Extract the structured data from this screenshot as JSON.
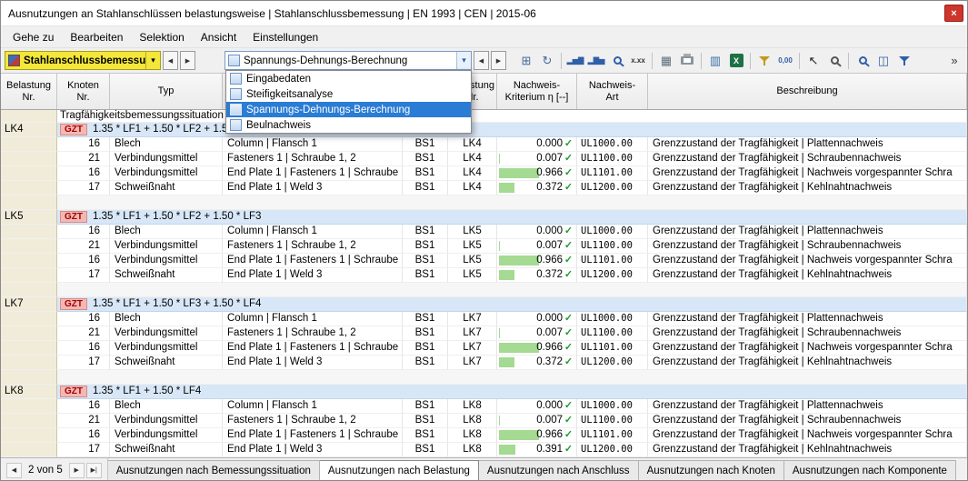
{
  "window": {
    "title": "Ausnutzungen an Stahlanschlüssen belastungsweise | Stahlanschlussbemessung | EN 1993 | CEN | 2015-06",
    "close_glyph": "×"
  },
  "menubar": {
    "items": [
      "Gehe zu",
      "Bearbeiten",
      "Selektion",
      "Ansicht",
      "Einstellungen"
    ]
  },
  "toolbar": {
    "module_combo": {
      "value": "Stahlanschlussbemessung"
    },
    "calc_combo": {
      "value": "Spannungs-Dehnungs-Berechnung"
    },
    "icons": [
      {
        "name": "copy-table-icon",
        "kind": "glyph",
        "glyph": "⊞",
        "color": "#44699d"
      },
      {
        "name": "recalculate-icon",
        "kind": "glyph",
        "glyph": "↻",
        "color": "#44699d"
      },
      {
        "kind": "sep"
      },
      {
        "name": "result-diagram-icon",
        "kind": "glyph",
        "glyph": "▂▅▇",
        "color": "#2f5fa8",
        "size": 8
      },
      {
        "name": "result-diagram-member-icon",
        "kind": "glyph",
        "glyph": "▂▇▅",
        "color": "#2f5fa8",
        "size": 8
      },
      {
        "name": "stress-view-icon",
        "kind": "magnifier",
        "color": "#2f5fa8"
      },
      {
        "name": "extreme-values-icon",
        "kind": "glyph",
        "glyph": "x.xx",
        "color": "#333333",
        "size": 8
      },
      {
        "kind": "sep"
      },
      {
        "name": "tables-icon",
        "kind": "glyph",
        "glyph": "▦",
        "color": "#5f6e7d"
      },
      {
        "name": "print-icon",
        "kind": "printer",
        "color": "#8a949e"
      },
      {
        "kind": "sep"
      },
      {
        "name": "result-chart-icon",
        "kind": "glyph",
        "glyph": "▥",
        "color": "#3a6ea5"
      },
      {
        "name": "excel-export-icon",
        "kind": "excel",
        "glyph": "X",
        "color": "#1e7145"
      },
      {
        "kind": "sep"
      },
      {
        "name": "filter-icon",
        "kind": "funnel",
        "color": "#c49a1a"
      },
      {
        "name": "decimal-places-icon",
        "kind": "glyph",
        "glyph": "0,00",
        "color": "#2f5fa8",
        "size": 8
      },
      {
        "kind": "sep"
      },
      {
        "name": "pointer-icon",
        "kind": "glyph",
        "glyph": "↖",
        "color": "#222222"
      },
      {
        "name": "search-icon",
        "kind": "magnifier",
        "color": "#555555"
      },
      {
        "kind": "sep"
      },
      {
        "name": "zoom-icon",
        "kind": "magnifier",
        "color": "#2f5fa8"
      },
      {
        "name": "panels-icon",
        "kind": "glyph",
        "glyph": "◫",
        "color": "#2f5fa8"
      },
      {
        "name": "filter-results-icon",
        "kind": "funnel",
        "color": "#2f5fa8"
      },
      {
        "name": "more-buttons-icon",
        "kind": "glyph",
        "glyph": "»",
        "color": "#333333"
      }
    ]
  },
  "dropdown": {
    "items": [
      {
        "label": "Eingabedaten",
        "selected": false
      },
      {
        "label": "Steifigkeitsanalyse",
        "selected": false
      },
      {
        "label": "Spannungs-Dehnungs-Berechnung",
        "selected": true
      },
      {
        "label": "Beulnachweis",
        "selected": false
      }
    ]
  },
  "table": {
    "headers": {
      "c1a": "Belastung",
      "c1b": "Nr.",
      "c2a": "Knoten",
      "c2b": "Nr.",
      "c3": "Typ",
      "c4": "",
      "c5": "",
      "c6a": "Belastung",
      "c6b": "Nr.",
      "c7a": "Nachweis-",
      "c7b": "Kriterium η [--]",
      "c8a": "Nachweis-",
      "c8b": "Art",
      "c9": "Beschreibung"
    },
    "section_label": "Tragfähigkeitsbemessungssituation",
    "check_glyph": "✓",
    "colors": {
      "eta_bar": "#a4da92",
      "check": "#1d9e2f",
      "badge_bg": "#f3b8b4",
      "badge_text": "#a40000",
      "group_row_bg": "#d8e7f7",
      "row_header_bg": "#f1ecda",
      "selection_blue": "#2a7cd4",
      "module_combo_yellow": "#f3e73b"
    },
    "groups": [
      {
        "id": "LK4",
        "badge": "GZT",
        "formula": "1.35 * LF1 + 1.50 * LF2 + 1.50 * LF3 + 1.50 * LF4",
        "rows": [
          {
            "knoten": "16",
            "typ": "Blech",
            "komponente": "Column | Flansch 1",
            "bs": "BS1",
            "belastung": "LK4",
            "eta": "0.000",
            "eta_value": 0.0,
            "art": "UL1000.00",
            "beschreibung": "Grenzzustand der Tragfähigkeit | Plattennachweis"
          },
          {
            "knoten": "21",
            "typ": "Verbindungsmittel",
            "komponente": "Fasteners 1 | Schraube 1, 2",
            "bs": "BS1",
            "belastung": "LK4",
            "eta": "0.007",
            "eta_value": 0.007,
            "art": "UL1100.00",
            "beschreibung": "Grenzzustand der Tragfähigkeit | Schraubennachweis"
          },
          {
            "knoten": "16",
            "typ": "Verbindungsmittel",
            "komponente": "End Plate 1 | Fasteners 1 | Schraube 1, 2",
            "bs": "BS1",
            "belastung": "LK4",
            "eta": "0.966",
            "eta_value": 0.966,
            "art": "UL1101.00",
            "beschreibung": "Grenzzustand der Tragfähigkeit | Nachweis vorgespannter Schra"
          },
          {
            "knoten": "17",
            "typ": "Schweißnaht",
            "komponente": "End Plate 1 | Weld 3",
            "bs": "BS1",
            "belastung": "LK4",
            "eta": "0.372",
            "eta_value": 0.372,
            "art": "UL1200.00",
            "beschreibung": "Grenzzustand der Tragfähigkeit | Kehlnahtnachweis"
          }
        ]
      },
      {
        "id": "LK5",
        "badge": "GZT",
        "formula": "1.35 * LF1 + 1.50 * LF2 + 1.50 * LF3",
        "rows": [
          {
            "knoten": "16",
            "typ": "Blech",
            "komponente": "Column | Flansch 1",
            "bs": "BS1",
            "belastung": "LK5",
            "eta": "0.000",
            "eta_value": 0.0,
            "art": "UL1000.00",
            "beschreibung": "Grenzzustand der Tragfähigkeit | Plattennachweis"
          },
          {
            "knoten": "21",
            "typ": "Verbindungsmittel",
            "komponente": "Fasteners 1 | Schraube 1, 2",
            "bs": "BS1",
            "belastung": "LK5",
            "eta": "0.007",
            "eta_value": 0.007,
            "art": "UL1100.00",
            "beschreibung": "Grenzzustand der Tragfähigkeit | Schraubennachweis"
          },
          {
            "knoten": "16",
            "typ": "Verbindungsmittel",
            "komponente": "End Plate 1 | Fasteners 1 | Schraube 1, 2",
            "bs": "BS1",
            "belastung": "LK5",
            "eta": "0.966",
            "eta_value": 0.966,
            "art": "UL1101.00",
            "beschreibung": "Grenzzustand der Tragfähigkeit | Nachweis vorgespannter Schra"
          },
          {
            "knoten": "17",
            "typ": "Schweißnaht",
            "komponente": "End Plate 1 | Weld 3",
            "bs": "BS1",
            "belastung": "LK5",
            "eta": "0.372",
            "eta_value": 0.372,
            "art": "UL1200.00",
            "beschreibung": "Grenzzustand der Tragfähigkeit | Kehlnahtnachweis"
          }
        ]
      },
      {
        "id": "LK7",
        "badge": "GZT",
        "formula": "1.35 * LF1 + 1.50 * LF3 + 1.50 * LF4",
        "rows": [
          {
            "knoten": "16",
            "typ": "Blech",
            "komponente": "Column | Flansch 1",
            "bs": "BS1",
            "belastung": "LK7",
            "eta": "0.000",
            "eta_value": 0.0,
            "art": "UL1000.00",
            "beschreibung": "Grenzzustand der Tragfähigkeit | Plattennachweis"
          },
          {
            "knoten": "21",
            "typ": "Verbindungsmittel",
            "komponente": "Fasteners 1 | Schraube 1, 2",
            "bs": "BS1",
            "belastung": "LK7",
            "eta": "0.007",
            "eta_value": 0.007,
            "art": "UL1100.00",
            "beschreibung": "Grenzzustand der Tragfähigkeit | Schraubennachweis"
          },
          {
            "knoten": "16",
            "typ": "Verbindungsmittel",
            "komponente": "End Plate 1 | Fasteners 1 | Schraube 1, 2",
            "bs": "BS1",
            "belastung": "LK7",
            "eta": "0.966",
            "eta_value": 0.966,
            "art": "UL1101.00",
            "beschreibung": "Grenzzustand der Tragfähigkeit | Nachweis vorgespannter Schra"
          },
          {
            "knoten": "17",
            "typ": "Schweißnaht",
            "komponente": "End Plate 1 | Weld 3",
            "bs": "BS1",
            "belastung": "LK7",
            "eta": "0.372",
            "eta_value": 0.372,
            "art": "UL1200.00",
            "beschreibung": "Grenzzustand der Tragfähigkeit | Kehlnahtnachweis"
          }
        ]
      },
      {
        "id": "LK8",
        "badge": "GZT",
        "formula": "1.35 * LF1 + 1.50 * LF4",
        "rows": [
          {
            "knoten": "16",
            "typ": "Blech",
            "komponente": "Column | Flansch 1",
            "bs": "BS1",
            "belastung": "LK8",
            "eta": "0.000",
            "eta_value": 0.0,
            "art": "UL1000.00",
            "beschreibung": "Grenzzustand der Tragfähigkeit | Plattennachweis"
          },
          {
            "knoten": "21",
            "typ": "Verbindungsmittel",
            "komponente": "Fasteners 1 | Schraube 1, 2",
            "bs": "BS1",
            "belastung": "LK8",
            "eta": "0.007",
            "eta_value": 0.007,
            "art": "UL1100.00",
            "beschreibung": "Grenzzustand der Tragfähigkeit | Schraubennachweis"
          },
          {
            "knoten": "16",
            "typ": "Verbindungsmittel",
            "komponente": "End Plate 1 | Fasteners 1 | Schraube 1, 2",
            "bs": "BS1",
            "belastung": "LK8",
            "eta": "0.966",
            "eta_value": 0.966,
            "art": "UL1101.00",
            "beschreibung": "Grenzzustand der Tragfähigkeit | Nachweis vorgespannter Schra"
          },
          {
            "knoten": "17",
            "typ": "Schweißnaht",
            "komponente": "End Plate 1 | Weld 3",
            "bs": "BS1",
            "belastung": "LK8",
            "eta": "0.391",
            "eta_value": 0.391,
            "art": "UL1200.00",
            "beschreibung": "Grenzzustand der Tragfähigkeit | Kehlnahtnachweis"
          }
        ]
      }
    ]
  },
  "statusbar": {
    "pager": "2 von 5",
    "tabs": [
      {
        "label": "Ausnutzungen nach Bemessungssituation",
        "active": false
      },
      {
        "label": "Ausnutzungen nach Belastung",
        "active": true
      },
      {
        "label": "Ausnutzungen nach Anschluss",
        "active": false
      },
      {
        "label": "Ausnutzungen nach Knoten",
        "active": false
      },
      {
        "label": "Ausnutzungen nach Komponente",
        "active": false
      }
    ]
  }
}
